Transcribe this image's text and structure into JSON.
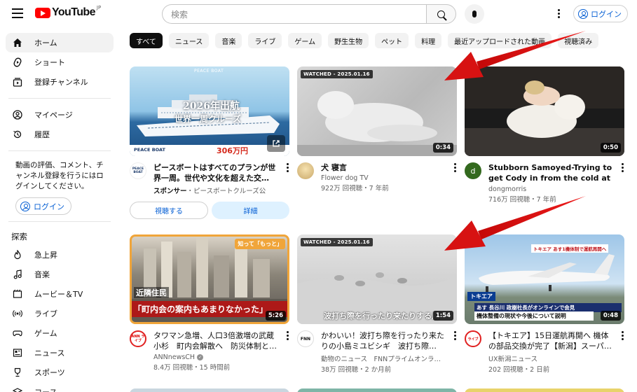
{
  "header": {
    "logo_text": "YouTube",
    "logo_region": "JP",
    "search_placeholder": "検索",
    "login_label": "ログイン"
  },
  "sidebar": {
    "main_items": [
      {
        "label": "ホーム",
        "icon": "home-icon",
        "active": true
      },
      {
        "label": "ショート",
        "icon": "shorts-icon"
      },
      {
        "label": "登録チャンネル",
        "icon": "subscriptions-icon"
      }
    ],
    "you_items": [
      {
        "label": "マイページ",
        "icon": "you-icon"
      },
      {
        "label": "履歴",
        "icon": "history-icon"
      }
    ],
    "signin_message": "動画の評価、コメント、チャンネル登録を行うにはログインしてください。",
    "signin_button": "ログイン",
    "explore_heading": "探索",
    "explore_items": [
      {
        "label": "急上昇",
        "icon": "trending-icon"
      },
      {
        "label": "音楽",
        "icon": "music-icon"
      },
      {
        "label": "ムービー＆TV",
        "icon": "movies-icon"
      },
      {
        "label": "ライブ",
        "icon": "live-icon"
      },
      {
        "label": "ゲーム",
        "icon": "gaming-icon"
      },
      {
        "label": "ニュース",
        "icon": "news-icon"
      },
      {
        "label": "スポーツ",
        "icon": "sports-icon"
      },
      {
        "label": "コース",
        "icon": "courses-icon"
      }
    ]
  },
  "chips": [
    "すべて",
    "ニュース",
    "音楽",
    "ライブ",
    "ゲーム",
    "野生生物",
    "ペット",
    "料理",
    "最近アップロードされた動画",
    "視聴済み"
  ],
  "ad": {
    "title": "ピースボートはすべてのプランが世界一周。世代や文化を超えた交…",
    "sponsor_label": "スポンサー",
    "sponsor_name": "ピースボートクルーズ公",
    "thumb_brand": "PEACE BOAT",
    "thumb_headline_1": "2026年出航",
    "thumb_headline_2": "世界一周クルーズ",
    "thumb_price": "306万円",
    "watch_button": "視聴する",
    "details_button": "詳細"
  },
  "videos": [
    {
      "title": "犬 寝言",
      "channel": "Flower dog TV",
      "stats": "922万 回視聴・7 年前",
      "duration": "0:34",
      "watched": "WATCHED - 2025.01.16"
    },
    {
      "title": "Stubborn Samoyed-Trying to get Cody in from the cold at bedtime.",
      "channel": "dongmorris",
      "avatar_letter": "d",
      "stats": "716万 回視聴・7 年前",
      "duration": "0:50"
    },
    {
      "title": "タワマン急増、人口3倍激増の武蔵小杉　町内会解散へ　防災体制と…",
      "channel": "ANNnewsCH",
      "stats": "8.4万 回視聴・15 時間前",
      "duration": "5:26",
      "thumb_tag": "知って「もっと」",
      "thumb_caption_1": "近隣住民",
      "thumb_caption_2": "「町内会の案内もあまりなかった」",
      "avatar_label": "ANN ライブ"
    },
    {
      "title": "かわいい！波打ち際を行ったり来たりの小島ミユビシギ　波打ち際…",
      "channel": "動物のニュース　FNNプライムオンラ…",
      "stats": "38万 回視聴・2 か月前",
      "duration": "1:54",
      "watched": "WATCHED - 2025.01.16",
      "thumb_caption": "波打ち際を行ったり来たりする鳥",
      "avatar_label": "FNN"
    },
    {
      "title": "【トキエア】15日運航再開へ 機体の部品交換が完了【新潟】スーパ…",
      "channel": "UX新潟ニュース",
      "stats": "202 回視聴・2 日前",
      "duration": "0:48",
      "thumb_banner": "トキエア あす1機体制で運航再開へ",
      "thumb_caption_1": "あす 長谷川 政樹社長がオンラインで会見",
      "thumb_caption_2": "機体整備の現状や今後について説明",
      "thumb_tag": "トキエア",
      "avatar_label": "ライブ"
    }
  ],
  "colors": {
    "accent_blue": "#065fd4",
    "youtube_red": "#ff0000",
    "arrow_red": "#e01010"
  }
}
